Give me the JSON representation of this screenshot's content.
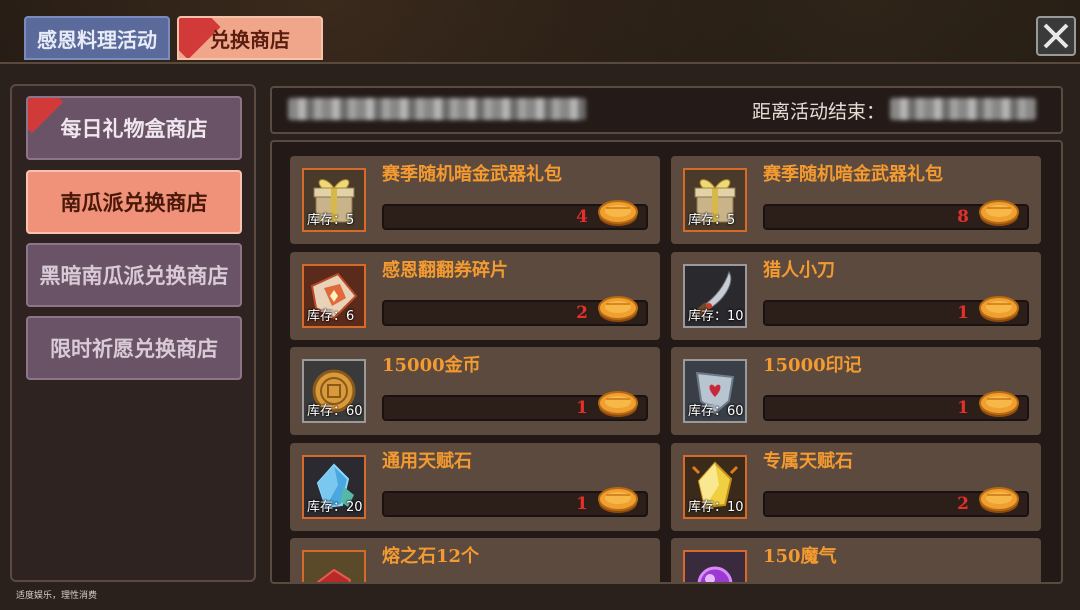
{
  "tabs": [
    {
      "label": "感恩料理活动"
    },
    {
      "label": "兑换商店"
    }
  ],
  "sidebar": {
    "items": [
      {
        "label": "每日礼物盒商店"
      },
      {
        "label": "南瓜派兑换商店"
      },
      {
        "label": "黑暗南瓜派兑换商店"
      },
      {
        "label": "限时祈愿兑换商店"
      }
    ]
  },
  "header": {
    "countdown_label": "距离活动结束："
  },
  "stock_prefix": "库存：",
  "items": [
    {
      "name": "赛季随机暗金武器礼包",
      "stock": "5",
      "price": "4",
      "icon": "gift-box-icon"
    },
    {
      "name": "赛季随机暗金武器礼包",
      "stock": "5",
      "price": "8",
      "icon": "gift-box-icon"
    },
    {
      "name": "感恩翻翻券碎片",
      "stock": "6",
      "price": "2",
      "icon": "ticket-fragment-icon"
    },
    {
      "name": "猎人小刀",
      "stock": "10",
      "price": "1",
      "icon": "knife-icon"
    },
    {
      "name": "15000金币",
      "stock": "60",
      "price": "1",
      "icon": "gold-coin-icon"
    },
    {
      "name": "15000印记",
      "stock": "60",
      "price": "1",
      "icon": "emblem-icon"
    },
    {
      "name": "通用天赋石",
      "stock": "20",
      "price": "1",
      "icon": "blue-crystal-icon"
    },
    {
      "name": "专属天赋石",
      "stock": "10",
      "price": "2",
      "icon": "gold-crystal-icon"
    },
    {
      "name": "熔之石12个",
      "stock": "",
      "price": "",
      "icon": "red-stone-icon"
    },
    {
      "name": "150魔气",
      "stock": "",
      "price": "",
      "icon": "purple-orb-icon"
    }
  ],
  "price_currency_icon": "pumpkin-pie-icon",
  "footnote": "适度娱乐，理性消费",
  "colors": {
    "item_name": "#f39a30",
    "price": "#e4302a",
    "active_tab": "#f0927a"
  }
}
